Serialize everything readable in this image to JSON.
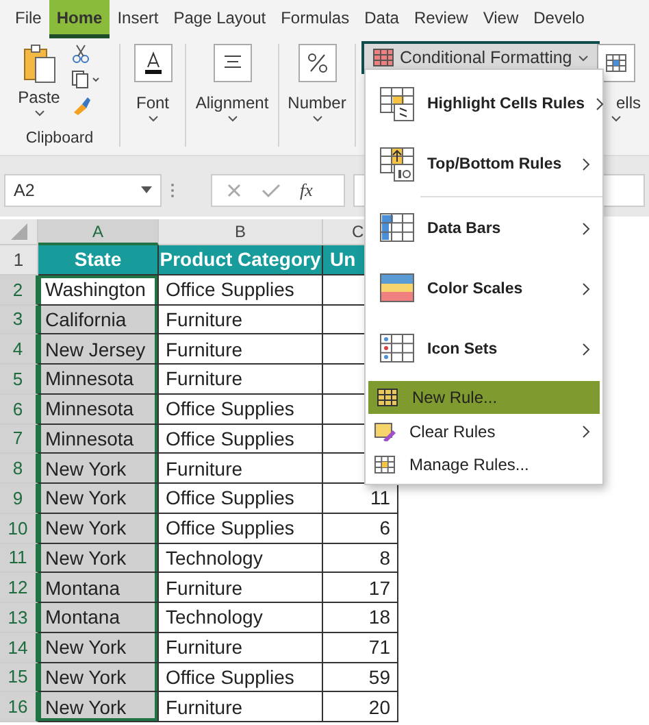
{
  "ribbon_tabs": [
    {
      "label": "File",
      "selected": false
    },
    {
      "label": "Home",
      "selected": true
    },
    {
      "label": "Insert",
      "selected": false
    },
    {
      "label": "Page Layout",
      "selected": false
    },
    {
      "label": "Formulas",
      "selected": false
    },
    {
      "label": "Data",
      "selected": false
    },
    {
      "label": "Review",
      "selected": false
    },
    {
      "label": "View",
      "selected": false
    },
    {
      "label": "Develo",
      "selected": false
    }
  ],
  "ribbon": {
    "groups": [
      {
        "kind": "clipboard",
        "label": "Paste",
        "caption": "Clipboard"
      },
      {
        "kind": "font",
        "label": "Font"
      },
      {
        "kind": "alignment",
        "label": "Alignment"
      },
      {
        "kind": "number",
        "label": "Number"
      },
      {
        "kind": "conditional",
        "label": "Conditional Formatting",
        "open": true
      },
      {
        "kind": "cells",
        "label": "ells"
      }
    ]
  },
  "formula_bar": {
    "name_box": "A2",
    "function_label": "fx"
  },
  "sheet": {
    "columns": [
      {
        "label": "A",
        "selected": true
      },
      {
        "label": "B",
        "selected": false
      },
      {
        "label": "C",
        "selected": false
      }
    ],
    "rows": [
      {
        "number": "1",
        "kind": "header",
        "selected": false,
        "cells": [
          "State",
          "Product Category",
          "Un"
        ]
      },
      {
        "number": "2",
        "kind": "data",
        "selected": true,
        "active": true,
        "cells": [
          "Washington",
          "Office Supplies"
        ]
      },
      {
        "number": "3",
        "kind": "data",
        "selected": true,
        "active": false,
        "cells": [
          "California",
          "Furniture"
        ]
      },
      {
        "number": "4",
        "kind": "data",
        "selected": true,
        "active": false,
        "cells": [
          "New Jersey",
          "Furniture"
        ]
      },
      {
        "number": "5",
        "kind": "data",
        "selected": true,
        "active": false,
        "cells": [
          "Minnesota",
          "Furniture"
        ]
      },
      {
        "number": "6",
        "kind": "data",
        "selected": true,
        "active": false,
        "cells": [
          "Minnesota",
          "Office Supplies"
        ]
      },
      {
        "number": "7",
        "kind": "data",
        "selected": true,
        "active": false,
        "cells": [
          "Minnesota",
          "Office Supplies"
        ]
      },
      {
        "number": "8",
        "kind": "data",
        "selected": true,
        "active": false,
        "cells": [
          "New York",
          "Furniture"
        ]
      },
      {
        "number": "9",
        "kind": "data",
        "selected": true,
        "active": false,
        "cells": [
          "New York",
          "Office Supplies",
          "11"
        ]
      },
      {
        "number": "10",
        "kind": "data",
        "selected": true,
        "active": false,
        "cells": [
          "New York",
          "Office Supplies",
          "6"
        ]
      },
      {
        "number": "11",
        "kind": "data",
        "selected": true,
        "active": false,
        "cells": [
          "New York",
          "Technology",
          "8"
        ]
      },
      {
        "number": "12",
        "kind": "data",
        "selected": true,
        "active": false,
        "cells": [
          "Montana",
          "Furniture",
          "17"
        ]
      },
      {
        "number": "13",
        "kind": "data",
        "selected": true,
        "active": false,
        "cells": [
          "Montana",
          "Technology",
          "18"
        ]
      },
      {
        "number": "14",
        "kind": "data",
        "selected": true,
        "active": false,
        "cells": [
          "New York",
          "Furniture",
          "71"
        ]
      },
      {
        "number": "15",
        "kind": "data",
        "selected": true,
        "active": false,
        "cells": [
          "New York",
          "Office Supplies",
          "59"
        ]
      },
      {
        "number": "16",
        "kind": "data",
        "selected": true,
        "active": false,
        "cells": [
          "New York",
          "Furniture",
          "20"
        ]
      }
    ]
  },
  "menu": {
    "items": [
      {
        "kind": "large",
        "label": "Highlight Cells Rules",
        "submenu": true,
        "selected": false
      },
      {
        "kind": "large",
        "label": "Top/Bottom Rules",
        "submenu": true,
        "selected": false
      },
      {
        "kind": "separator"
      },
      {
        "kind": "large",
        "label": "Data Bars",
        "submenu": true,
        "selected": false
      },
      {
        "kind": "large",
        "label": "Color Scales",
        "submenu": true,
        "selected": false
      },
      {
        "kind": "large",
        "label": "Icon Sets",
        "submenu": true,
        "selected": false
      },
      {
        "kind": "small",
        "label": "New Rule...",
        "submenu": false,
        "selected": true
      },
      {
        "kind": "small",
        "label": "Clear Rules",
        "submenu": true,
        "selected": false
      },
      {
        "kind": "small",
        "label": "Manage Rules...",
        "submenu": false,
        "selected": false
      }
    ]
  }
}
